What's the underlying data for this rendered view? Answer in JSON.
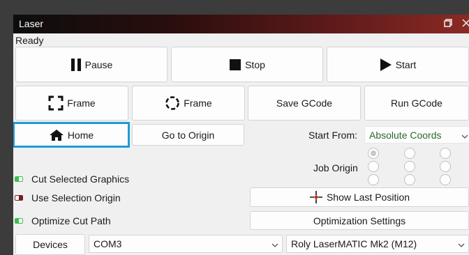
{
  "window": {
    "title": "Laser",
    "restore_icon": "restore-icon",
    "close_icon": "close-icon"
  },
  "status": "Ready",
  "controls": {
    "pause": "Pause",
    "stop": "Stop",
    "start": "Start",
    "frame_rect": "Frame",
    "frame_circle": "Frame",
    "save_gcode": "Save GCode",
    "run_gcode": "Run GCode",
    "home": "Home",
    "go_to_origin": "Go to Origin"
  },
  "start_from": {
    "label": "Start From:",
    "value": "Absolute Coords"
  },
  "job_origin": {
    "label": "Job Origin",
    "selected": "top-left"
  },
  "options": [
    {
      "label": "Cut Selected Graphics",
      "on": true
    },
    {
      "label": "Use Selection Origin",
      "on": false
    },
    {
      "label": "Optimize Cut Path",
      "on": true
    }
  ],
  "show_last_position": "Show Last Position",
  "optimization_settings": "Optimization Settings",
  "devices": {
    "label": "Devices",
    "port": "COM3",
    "machine": "Roly LaserMATIC Mk2 (M12)"
  },
  "colors": {
    "focus": "#1e9bd7",
    "toggle_on": "#3cbf4a",
    "toggle_off": "#7a1f1f",
    "crosshair": "#d9261c"
  }
}
